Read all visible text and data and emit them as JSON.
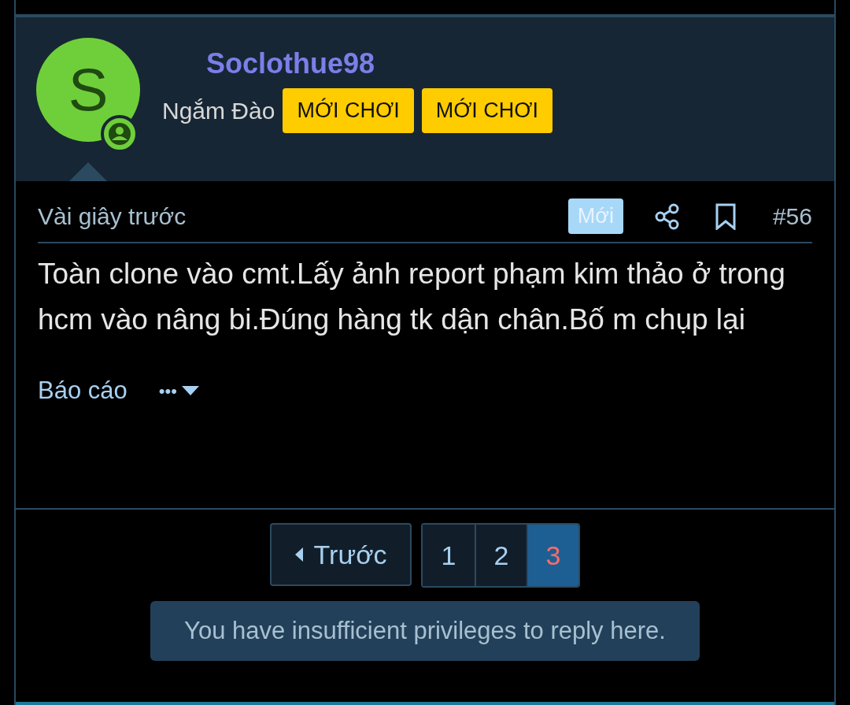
{
  "post": {
    "avatar_letter": "S",
    "username": "Soclothue98",
    "user_title": "Ngắm Đào",
    "badges": [
      "MỚI CHƠI",
      "MỚI CHƠI"
    ],
    "time": "Vài giây trước",
    "new_label": "Mới",
    "post_number": "#56",
    "message": "Toàn clone vào cmt.Lấy ảnh report phạm kim thảo ở trong hcm vào nâng bi.Đúng hàng tk dận chân.Bố m chụp lại",
    "report_link": "Báo cáo",
    "more_label": "•••"
  },
  "pagination": {
    "prev_label": "Trước",
    "pages": [
      {
        "label": "1",
        "selected": false
      },
      {
        "label": "2",
        "selected": false
      },
      {
        "label": "3",
        "selected": true
      }
    ]
  },
  "notice": "You have insufficient privileges to reply here."
}
